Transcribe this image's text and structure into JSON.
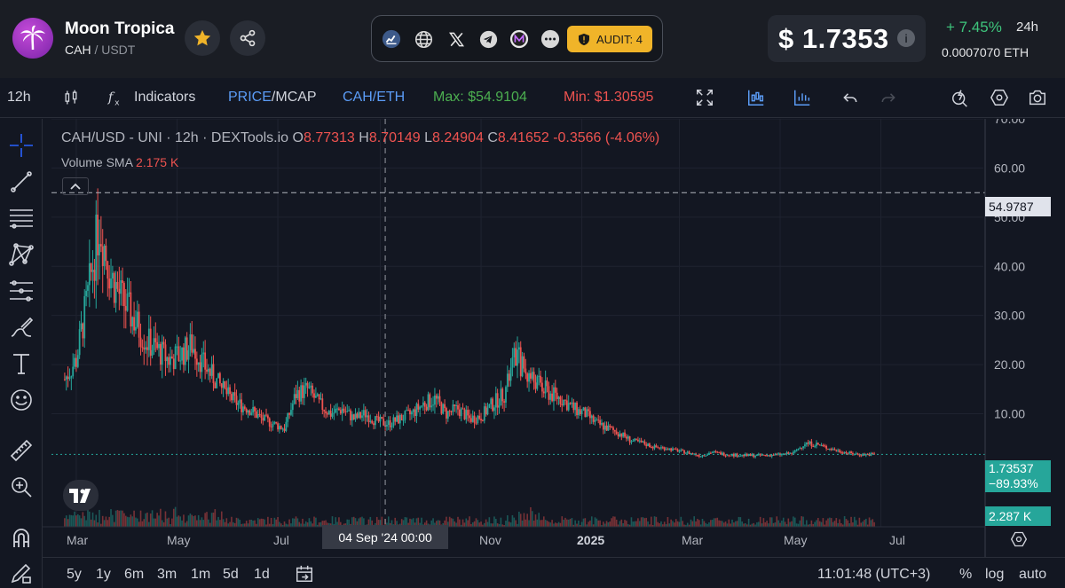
{
  "header": {
    "token_name": "Moon Tropica",
    "base": "CAH",
    "quote": "USDT",
    "audit_label": "AUDIT: 4",
    "price": "$ 1.7353",
    "change_pct": "+ 7.45%",
    "change_period": "24h",
    "eth_price": "0.0007070  ETH",
    "social_icons": [
      "chart-icon",
      "globe-icon",
      "x-twitter-icon",
      "telegram-icon",
      "m-logo-icon",
      "more-icon"
    ]
  },
  "toolbar": {
    "interval": "12h",
    "indicators_label": "Indicators",
    "price_label": "PRICE",
    "mcap_label": "MCAP",
    "pair_label": "CAH/ETH",
    "max_label": "Max: $54.9104",
    "min_label": "Min: $1.30595"
  },
  "legend": {
    "title": "CAH/USD - UNI · 12h · DEXTools.io",
    "o_label": "O",
    "o_val": "8.77313",
    "h_label": "H",
    "h_val": "8.70149",
    "l_label": "L",
    "l_val": "8.24904",
    "c_label": "C",
    "c_val": "8.41652",
    "change": "-0.3566 (-4.06%)",
    "volume_label": "Volume SMA",
    "volume_val": "2.175 K"
  },
  "axis": {
    "price_ticks": [
      "70.00",
      "60.00",
      "50.00",
      "40.00",
      "30.00",
      "20.00",
      "10.00"
    ],
    "months": [
      "Mar",
      "May",
      "Jul",
      "Nov",
      "2025",
      "Mar",
      "May",
      "Jul"
    ],
    "crosshair_time": "04 Sep '24   00:00",
    "max_tag": "54.9787",
    "current_price": "1.73537",
    "current_change": "−89.93%",
    "volume_tag": "2.287 K"
  },
  "bottombar": {
    "ranges": [
      "5y",
      "1y",
      "6m",
      "3m",
      "1m",
      "5d",
      "1d"
    ],
    "clock": "11:01:48 (UTC+3)",
    "percent_label": "%",
    "log_label": "log",
    "auto_label": "auto"
  },
  "colors": {
    "up": "#26a69a",
    "down": "#ef5350",
    "accent": "#2962ff",
    "audit": "#f0b429",
    "positive": "#3ec57c"
  },
  "chart_data": {
    "type": "candlestick",
    "title": "CAH/USD - UNI · 12h · DEXTools.io",
    "x": [
      "2024-02-23",
      "2024-03-01",
      "2024-03-08",
      "2024-03-15",
      "2024-03-22",
      "2024-03-29",
      "2024-04-05",
      "2024-04-12",
      "2024-04-19",
      "2024-04-26",
      "2024-05-03",
      "2024-05-10",
      "2024-05-17",
      "2024-05-24",
      "2024-05-31",
      "2024-06-07",
      "2024-06-14",
      "2024-06-21",
      "2024-06-28",
      "2024-07-05",
      "2024-07-12",
      "2024-07-19",
      "2024-07-26",
      "2024-08-02",
      "2024-08-09",
      "2024-08-16",
      "2024-08-23",
      "2024-08-30",
      "2024-09-06",
      "2024-09-13",
      "2024-09-20",
      "2024-09-27",
      "2024-10-04",
      "2024-10-11",
      "2024-10-18",
      "2024-10-25",
      "2024-11-01",
      "2024-11-08",
      "2024-11-15",
      "2024-11-22",
      "2024-11-29",
      "2024-12-06",
      "2024-12-13",
      "2024-12-20",
      "2024-12-27",
      "2025-01-03",
      "2025-01-10",
      "2025-01-17",
      "2025-01-24",
      "2025-01-31",
      "2025-02-07",
      "2025-02-14",
      "2025-02-21",
      "2025-02-28",
      "2025-03-07",
      "2025-03-14",
      "2025-03-21",
      "2025-03-28",
      "2025-04-04",
      "2025-04-11",
      "2025-04-18",
      "2025-04-25",
      "2025-05-02",
      "2025-05-09",
      "2025-05-16",
      "2025-05-23",
      "2025-05-30",
      "2025-06-06",
      "2025-06-13",
      "2025-06-20",
      "2025-06-27"
    ],
    "close": [
      17,
      21,
      34,
      49,
      38,
      33,
      29,
      25,
      23,
      21,
      22,
      24,
      20,
      17,
      14,
      12,
      11,
      9,
      8,
      7,
      14,
      15,
      12,
      10,
      11,
      9,
      10,
      8.4,
      8,
      9,
      10,
      12,
      13,
      10,
      11,
      9,
      9.5,
      12,
      14,
      22,
      18,
      16,
      14,
      13,
      11,
      10,
      8,
      7,
      6,
      4.5,
      4,
      3.2,
      3,
      2.5,
      2,
      1.5,
      2.2,
      1.8,
      1.6,
      1.5,
      1.5,
      1.6,
      1.7,
      2,
      4,
      3.8,
      3,
      2.4,
      1.9,
      1.7,
      1.74
    ],
    "ylim": [
      -13,
      70
    ],
    "y_ticks": [
      10,
      20,
      30,
      40,
      50,
      60,
      70
    ],
    "max_line": 54.9787,
    "last_price": 1.73537,
    "crosshair": "2024-09-04"
  }
}
